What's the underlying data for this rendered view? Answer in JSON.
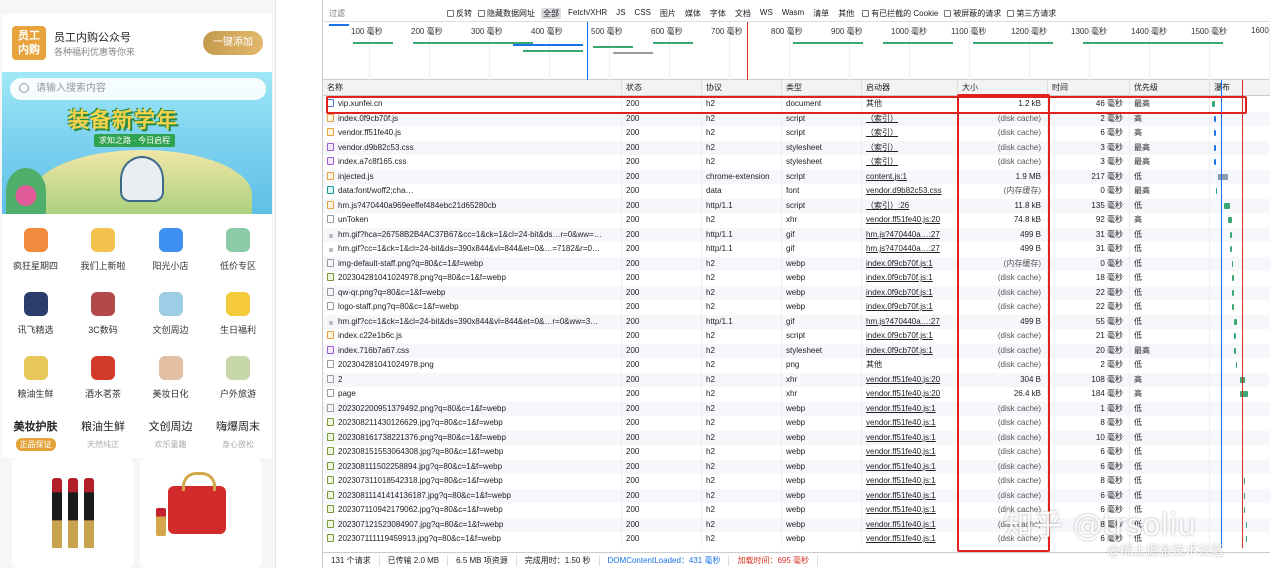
{
  "mobile": {
    "logo_text": "员工\n内购",
    "account_title": "员工内购公众号",
    "account_sub": "各种福利优惠等你来",
    "add_button": "一键添加",
    "search_placeholder": "请输入搜索内容",
    "banner_title": "装备新学年",
    "banner_tag": "求知之路 · 今日启程",
    "grid": [
      {
        "label": "疯狂星期四",
        "color": "#f08a3c"
      },
      {
        "label": "我们上新啦",
        "color": "#f3c24e"
      },
      {
        "label": "阳光小店",
        "color": "#3d8ff0"
      },
      {
        "label": "低价专区",
        "color": "#8cc9a6"
      },
      {
        "label": "讯飞精选",
        "color": "#2a3d6b"
      },
      {
        "label": "3C数码",
        "color": "#b34a4a"
      },
      {
        "label": "文创周边",
        "color": "#9ecde6"
      },
      {
        "label": "生日福利",
        "color": "#f4c93a"
      },
      {
        "label": "粮油生鲜",
        "color": "#e8c85a"
      },
      {
        "label": "酒水茗茶",
        "color": "#d23a2a"
      },
      {
        "label": "美妆日化",
        "color": "#e3bfa4"
      },
      {
        "label": "户外旅游",
        "color": "#c7d7a8"
      }
    ],
    "categories": [
      {
        "title": "美妆护肤",
        "sub": "正品保证"
      },
      {
        "title": "粮油生鲜",
        "sub": "天然纯正"
      },
      {
        "title": "文创周边",
        "sub": "欢乐童趣"
      },
      {
        "title": "嗨爆周末",
        "sub": "身心放松"
      }
    ]
  },
  "devtools": {
    "filter_placeholder": "过滤",
    "filter_checks": [
      "反转",
      "隐藏数据网址"
    ],
    "type_buttons": [
      "全部",
      "Fetch/XHR",
      "JS",
      "CSS",
      "图片",
      "媒体",
      "字体",
      "文档",
      "WS",
      "Wasm",
      "清单",
      "其他"
    ],
    "filter_checks2": [
      "有已拦截的 Cookie",
      "被屏蔽的请求",
      "第三方请求"
    ],
    "overview_ticks": [
      "100 毫秒",
      "200 毫秒",
      "300 毫秒",
      "400 毫秒",
      "500 毫秒",
      "600 毫秒",
      "700 毫秒",
      "800 毫秒",
      "900 毫秒",
      "1000 毫秒",
      "1100 毫秒",
      "1200 毫秒",
      "1300 毫秒",
      "1400 毫秒",
      "1500 毫秒",
      "1600"
    ],
    "columns": [
      "名称",
      "状态",
      "协议",
      "类型",
      "启动器",
      "大小",
      "时间",
      "优先级",
      "瀑布"
    ],
    "rows": [
      {
        "name": "vip.xunfei.cn",
        "icon": "doc",
        "status": "200",
        "protocol": "h2",
        "type": "document",
        "initiator": "其他",
        "size": "1.2 kB",
        "time": "46 毫秒",
        "priority": "最高"
      },
      {
        "name": "index.0f9cb70f.js",
        "icon": "js",
        "status": "200",
        "protocol": "h2",
        "type": "script",
        "initiator": "（索引）",
        "size": "(disk cache)",
        "time": "2 毫秒",
        "priority": "高"
      },
      {
        "name": "vendor.ff51fe40.js",
        "icon": "js",
        "status": "200",
        "protocol": "h2",
        "type": "script",
        "initiator": "（索引）",
        "size": "(disk cache)",
        "time": "6 毫秒",
        "priority": "高"
      },
      {
        "name": "vendor.d9b82c53.css",
        "icon": "css",
        "status": "200",
        "protocol": "h2",
        "type": "stylesheet",
        "initiator": "（索引）",
        "size": "(disk cache)",
        "time": "3 毫秒",
        "priority": "最高"
      },
      {
        "name": "index.a7c8f165.css",
        "icon": "css",
        "status": "200",
        "protocol": "h2",
        "type": "stylesheet",
        "initiator": "（索引）",
        "size": "(disk cache)",
        "time": "3 毫秒",
        "priority": "最高"
      },
      {
        "name": "injected.js",
        "icon": "js",
        "status": "200",
        "protocol": "chrome-extension",
        "type": "script",
        "initiator": "content.js:1",
        "size": "1.9 MB",
        "time": "217 毫秒",
        "priority": "低"
      },
      {
        "name": "data:font/woff2;cha…",
        "icon": "font",
        "status": "200",
        "protocol": "data",
        "type": "font",
        "initiator": "vendor.d9b82c53.css",
        "size": "(内存缓存)",
        "time": "0 毫秒",
        "priority": "最高"
      },
      {
        "name": "hm.js?470440a969eeffef484ebc21d65280cb",
        "icon": "js",
        "status": "200",
        "protocol": "http/1.1",
        "type": "script",
        "initiator": "（索引）:26",
        "size": "11.8 kB",
        "time": "135 毫秒",
        "priority": "低"
      },
      {
        "name": "unToken",
        "icon": "xhr",
        "status": "200",
        "protocol": "h2",
        "type": "xhr",
        "initiator": "vendor.ff51fe40.js:20",
        "size": "74.8 kB",
        "time": "92 毫秒",
        "priority": "高"
      },
      {
        "name": "hm.gif?hca=26758B2B4AC37B67&cc=1&ck=1&cl=24-bit&ds…r=0&ww=…",
        "icon": "gif",
        "status": "200",
        "protocol": "http/1.1",
        "type": "gif",
        "initiator": "hm.js?470440a…:27",
        "size": "499 B",
        "time": "31 毫秒",
        "priority": "低"
      },
      {
        "name": "hm.gif?cc=1&ck=1&cl=24-bit&ds=390x844&vl=844&et=0&…=7182&r=0…",
        "icon": "gif",
        "status": "200",
        "protocol": "http/1.1",
        "type": "gif",
        "initiator": "hm.js?470440a…:27",
        "size": "499 B",
        "time": "31 毫秒",
        "priority": "低"
      },
      {
        "name": "img-default-staff.png?q=80&c=1&f=webp",
        "icon": "xhr",
        "status": "200",
        "protocol": "h2",
        "type": "webp",
        "initiator": "index.0f9cb70f.js:1",
        "size": "(内存缓存)",
        "time": "0 毫秒",
        "priority": "低"
      },
      {
        "name": "20230428104102497​8.png?q=80&c=1&f=webp",
        "icon": "img",
        "status": "200",
        "protocol": "h2",
        "type": "webp",
        "initiator": "index.0f9cb70f.js:1",
        "size": "(disk cache)",
        "time": "18 毫秒",
        "priority": "低"
      },
      {
        "name": "qw-qr.png?q=80&c=1&f=webp",
        "icon": "xhr",
        "status": "200",
        "protocol": "h2",
        "type": "webp",
        "initiator": "index.0f9cb70f.js:1",
        "size": "(disk cache)",
        "time": "22 毫秒",
        "priority": "低"
      },
      {
        "name": "logo-staff.png?q=80&c=1&f=webp",
        "icon": "xhr",
        "status": "200",
        "protocol": "h2",
        "type": "webp",
        "initiator": "index.0f9cb70f.js:1",
        "size": "(disk cache)",
        "time": "22 毫秒",
        "priority": "低"
      },
      {
        "name": "hm.gif?cc=1&ck=1&cl=24-bit&ds=390x844&vl=844&et=0&…r=0&ww=3…",
        "icon": "gif",
        "status": "200",
        "protocol": "http/1.1",
        "type": "gif",
        "initiator": "hm.js?470440a…:27",
        "size": "499 B",
        "time": "55 毫秒",
        "priority": "低"
      },
      {
        "name": "index.c22e1b6c.js",
        "icon": "js",
        "status": "200",
        "protocol": "h2",
        "type": "script",
        "initiator": "index.0f9cb70f.js:1",
        "size": "(disk cache)",
        "time": "21 毫秒",
        "priority": "低"
      },
      {
        "name": "index.716b7a67.css",
        "icon": "css",
        "status": "200",
        "protocol": "h2",
        "type": "stylesheet",
        "initiator": "index.0f9cb70f.js:1",
        "size": "(disk cache)",
        "time": "20 毫秒",
        "priority": "最高"
      },
      {
        "name": "20230428104102497​8.png",
        "icon": "xhr",
        "status": "200",
        "protocol": "h2",
        "type": "png",
        "initiator": "其他",
        "size": "(disk cache)",
        "time": "2 毫秒",
        "priority": "低"
      },
      {
        "name": "2",
        "icon": "xhr",
        "status": "200",
        "protocol": "h2",
        "type": "xhr",
        "initiator": "vendor.ff51fe40.js:20",
        "size": "304 B",
        "time": "108 毫秒",
        "priority": "高"
      },
      {
        "name": "page",
        "icon": "xhr",
        "status": "200",
        "protocol": "h2",
        "type": "xhr",
        "initiator": "vendor.ff51fe40.js:20",
        "size": "26.4 kB",
        "time": "184 毫秒",
        "priority": "高"
      },
      {
        "name": "20230220095137949​2.png?q=80&c=1&f=webp",
        "icon": "xhr",
        "status": "200",
        "protocol": "h2",
        "type": "webp",
        "initiator": "vendor.ff51fe40.js:1",
        "size": "(disk cache)",
        "time": "1 毫秒",
        "priority": "低"
      },
      {
        "name": "20230821143012662​9.jpg?q=80&c=1&f=webp",
        "icon": "img",
        "status": "200",
        "protocol": "h2",
        "type": "webp",
        "initiator": "vendor.ff51fe40.js:1",
        "size": "(disk cache)",
        "time": "8 毫秒",
        "priority": "低"
      },
      {
        "name": "20230816173822137​6.png?q=80&c=1&f=webp",
        "icon": "img",
        "status": "200",
        "protocol": "h2",
        "type": "webp",
        "initiator": "vendor.ff51fe40.js:1",
        "size": "(disk cache)",
        "time": "10 毫秒",
        "priority": "低"
      },
      {
        "name": "20230815155306430​8.jpg?q=80&c=1&f=webp",
        "icon": "img",
        "status": "200",
        "protocol": "h2",
        "type": "webp",
        "initiator": "vendor.ff51fe40.js:1",
        "size": "(disk cache)",
        "time": "6 毫秒",
        "priority": "低"
      },
      {
        "name": "20230811150225889​4.jpg?q=80&c=1&f=webp",
        "icon": "img",
        "status": "200",
        "protocol": "h2",
        "type": "webp",
        "initiator": "vendor.ff51fe40.js:1",
        "size": "(disk cache)",
        "time": "6 毫秒",
        "priority": "低"
      },
      {
        "name": "20230731101854231​8.jpg?q=80&c=1&f=webp",
        "icon": "img",
        "status": "200",
        "protocol": "h2",
        "type": "webp",
        "initiator": "vendor.ff51fe40.js:1",
        "size": "(disk cache)",
        "time": "8 毫秒",
        "priority": "低"
      },
      {
        "name": "20230811141414136​187.jpg?q=80&c=1&f=webp",
        "icon": "img",
        "status": "200",
        "protocol": "h2",
        "type": "webp",
        "initiator": "vendor.ff51fe40.js:1",
        "size": "(disk cache)",
        "time": "6 毫秒",
        "priority": "低"
      },
      {
        "name": "20230711094217906​2.jpg?q=80&c=1&f=webp",
        "icon": "img",
        "status": "200",
        "protocol": "h2",
        "type": "webp",
        "initiator": "vendor.ff51fe40.js:1",
        "size": "(disk cache)",
        "time": "6 毫秒",
        "priority": "低"
      },
      {
        "name": "20230712152308490​7.jpg?q=80&c=1&f=webp",
        "icon": "img",
        "status": "200",
        "protocol": "h2",
        "type": "webp",
        "initiator": "vendor.ff51fe40.js:1",
        "size": "(disk cache)",
        "time": "8 毫秒",
        "priority": "低"
      },
      {
        "name": "20230711111945991​3.jpg?q=80&c=1&f=webp",
        "icon": "img",
        "status": "200",
        "protocol": "h2",
        "type": "webp",
        "initiator": "vendor.ff51fe40.js:1",
        "size": "(disk cache)",
        "time": "6 毫秒",
        "priority": "低"
      }
    ],
    "status_bar": {
      "requests": "131 个请求",
      "transferred": "已传输 2.0 MB",
      "resources": "6.5 MB 项资源",
      "finish": "完成用时：1.50 秒",
      "dom_loaded": "DOMContentLoaded：431 毫秒",
      "load": "加载时间：695 毫秒"
    }
  },
  "watermark": {
    "zhihu": "知乎 @trsoliu",
    "juejin": "@稀土掘金技术社区"
  },
  "colors": {
    "highlight": "#e0211e",
    "dom_line": "#1a73e8",
    "load_line": "#d93025"
  }
}
